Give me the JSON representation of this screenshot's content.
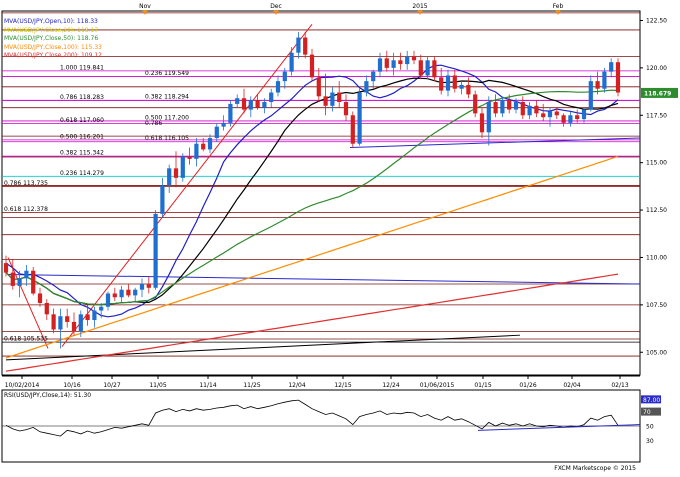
{
  "chart_data": [
    {
      "type": "candlestick",
      "symbol": "USDJPY",
      "legend": [
        {
          "label": "MVA(USD/JPY,Open,10): 118.33",
          "color": "#1e1ec8"
        },
        {
          "label": "MVA(USD/JPY,Close,20): 118.17",
          "color": "#cccc00"
        },
        {
          "label": "MVA(USD/JPY,Close,50): 118.76",
          "color": "#2e8b2e"
        },
        {
          "label": "MVA(USD/JPY,Close,100): 115.33",
          "color": "#ff8c00"
        },
        {
          "label": "MVA(USD/JPY,Close,200): 109.12",
          "color": "#e03030"
        }
      ],
      "top_month_labels": [
        "Nov",
        "Dec",
        "2015",
        "Feb"
      ],
      "x_tick_labels": [
        "10/02/2014",
        "10/16",
        "10/27",
        "11/05",
        "11/14",
        "11/25",
        "12/04",
        "12/15",
        "12/24",
        "01/06/2015",
        "01/15",
        "01/26",
        "02/04",
        "02/13"
      ],
      "y_tick_labels": [
        "122.50",
        "120.00",
        "117.50",
        "115.00",
        "112.50",
        "110.00",
        "107.50",
        "105.00"
      ],
      "ylim": [
        103.8,
        123.0
      ],
      "current_price": "118.679",
      "fib_levels": [
        {
          "label": "1.000 119.841",
          "value": 119.841,
          "color": "#cc00cc"
        },
        {
          "label": "0.236 119.549",
          "value": 119.549,
          "color": "#cc00cc"
        },
        {
          "label": "0.382 118.294",
          "value": 118.294,
          "color": "#cc00cc"
        },
        {
          "label": "0.786 118.283",
          "value": 118.283,
          "color": "#cc00cc"
        },
        {
          "label": "0.500 117.200",
          "value": 117.2,
          "color": "#cc00cc"
        },
        {
          "label": "0.618 117.060",
          "value": 117.06,
          "color": "#cc00cc"
        },
        {
          "label": "0.618 116.105",
          "value": 116.105,
          "color": "#cc00cc"
        },
        {
          "label": "0.500 116.201",
          "value": 116.201,
          "color": "#cc00cc"
        },
        {
          "label": "0.382 115.342",
          "value": 115.342,
          "color": "#cc00cc"
        },
        {
          "label": "0.236 114.279",
          "value": 114.279,
          "color": "#00cccc"
        },
        {
          "label": "0.786 113.735",
          "value": 113.735,
          "color": "#8b0000"
        },
        {
          "label": "0.618 112.378",
          "value": 112.378,
          "color": "#8b0000"
        },
        {
          "label": "0.618 105.535",
          "value": 105.535,
          "color": "#000000"
        }
      ],
      "label_7xx": "0.786",
      "candles": [
        {
          "o": 109.7,
          "h": 110.1,
          "l": 109.0,
          "c": 109.2
        },
        {
          "o": 109.2,
          "h": 109.9,
          "l": 108.3,
          "c": 108.5
        },
        {
          "o": 108.5,
          "h": 109.3,
          "l": 107.9,
          "c": 108.9
        },
        {
          "o": 108.9,
          "h": 109.6,
          "l": 108.5,
          "c": 109.3
        },
        {
          "o": 109.3,
          "h": 109.5,
          "l": 108.0,
          "c": 108.1
        },
        {
          "o": 108.1,
          "h": 108.4,
          "l": 107.4,
          "c": 107.6
        },
        {
          "o": 107.6,
          "h": 107.8,
          "l": 106.7,
          "c": 107.0
        },
        {
          "o": 107.0,
          "h": 107.3,
          "l": 106.0,
          "c": 106.2
        },
        {
          "o": 106.2,
          "h": 107.3,
          "l": 105.2,
          "c": 106.9
        },
        {
          "o": 106.9,
          "h": 107.3,
          "l": 106.3,
          "c": 106.6
        },
        {
          "o": 106.6,
          "h": 107.1,
          "l": 105.9,
          "c": 106.1
        },
        {
          "o": 106.1,
          "h": 107.2,
          "l": 105.8,
          "c": 107.0
        },
        {
          "o": 107.0,
          "h": 107.5,
          "l": 106.4,
          "c": 106.7
        },
        {
          "o": 106.7,
          "h": 107.4,
          "l": 106.3,
          "c": 107.2
        },
        {
          "o": 107.2,
          "h": 107.6,
          "l": 106.8,
          "c": 107.4
        },
        {
          "o": 107.4,
          "h": 108.2,
          "l": 107.2,
          "c": 108.1
        },
        {
          "o": 108.1,
          "h": 108.4,
          "l": 107.7,
          "c": 107.9
        },
        {
          "o": 107.9,
          "h": 108.5,
          "l": 107.6,
          "c": 108.3
        },
        {
          "o": 108.3,
          "h": 108.6,
          "l": 107.9,
          "c": 108.0
        },
        {
          "o": 108.0,
          "h": 108.4,
          "l": 107.7,
          "c": 108.3
        },
        {
          "o": 108.3,
          "h": 108.9,
          "l": 107.9,
          "c": 108.6
        },
        {
          "o": 108.6,
          "h": 109.0,
          "l": 108.1,
          "c": 108.4
        },
        {
          "o": 108.4,
          "h": 112.5,
          "l": 108.3,
          "c": 112.3
        },
        {
          "o": 112.3,
          "h": 114.2,
          "l": 112.1,
          "c": 113.8
        },
        {
          "o": 113.8,
          "h": 114.9,
          "l": 113.4,
          "c": 114.7
        },
        {
          "o": 114.7,
          "h": 115.6,
          "l": 113.7,
          "c": 114.2
        },
        {
          "o": 114.2,
          "h": 115.5,
          "l": 114.0,
          "c": 115.3
        },
        {
          "o": 115.3,
          "h": 115.8,
          "l": 114.9,
          "c": 115.2
        },
        {
          "o": 115.2,
          "h": 116.3,
          "l": 114.8,
          "c": 116.0
        },
        {
          "o": 116.0,
          "h": 116.3,
          "l": 115.6,
          "c": 115.7
        },
        {
          "o": 115.7,
          "h": 116.5,
          "l": 115.5,
          "c": 116.3
        },
        {
          "o": 116.3,
          "h": 117.1,
          "l": 116.1,
          "c": 116.9
        },
        {
          "o": 116.9,
          "h": 117.5,
          "l": 116.7,
          "c": 117.1
        },
        {
          "o": 117.1,
          "h": 118.3,
          "l": 116.9,
          "c": 118.1
        },
        {
          "o": 118.1,
          "h": 118.6,
          "l": 117.9,
          "c": 118.4
        },
        {
          "o": 118.4,
          "h": 118.9,
          "l": 117.6,
          "c": 117.8
        },
        {
          "o": 117.8,
          "h": 118.5,
          "l": 117.4,
          "c": 118.3
        },
        {
          "o": 118.3,
          "h": 118.6,
          "l": 117.8,
          "c": 117.9
        },
        {
          "o": 117.9,
          "h": 118.4,
          "l": 117.6,
          "c": 118.2
        },
        {
          "o": 118.2,
          "h": 118.9,
          "l": 117.9,
          "c": 118.7
        },
        {
          "o": 118.7,
          "h": 119.6,
          "l": 118.5,
          "c": 119.3
        },
        {
          "o": 119.3,
          "h": 120.0,
          "l": 118.9,
          "c": 119.8
        },
        {
          "o": 119.8,
          "h": 121.1,
          "l": 119.6,
          "c": 120.8
        },
        {
          "o": 120.8,
          "h": 121.9,
          "l": 120.5,
          "c": 121.6
        },
        {
          "o": 121.6,
          "h": 121.9,
          "l": 120.5,
          "c": 120.7
        },
        {
          "o": 120.7,
          "h": 121.0,
          "l": 119.3,
          "c": 119.5
        },
        {
          "o": 119.5,
          "h": 120.0,
          "l": 118.2,
          "c": 118.5
        },
        {
          "o": 118.5,
          "h": 119.7,
          "l": 117.5,
          "c": 118.0
        },
        {
          "o": 118.0,
          "h": 119.0,
          "l": 117.7,
          "c": 118.7
        },
        {
          "o": 118.7,
          "h": 119.3,
          "l": 117.9,
          "c": 118.2
        },
        {
          "o": 118.2,
          "h": 118.6,
          "l": 117.2,
          "c": 117.5
        },
        {
          "o": 117.5,
          "h": 117.7,
          "l": 115.8,
          "c": 116.0
        },
        {
          "o": 116.0,
          "h": 118.9,
          "l": 115.9,
          "c": 118.7
        },
        {
          "o": 118.7,
          "h": 119.6,
          "l": 118.5,
          "c": 119.3
        },
        {
          "o": 119.3,
          "h": 119.9,
          "l": 118.9,
          "c": 119.8
        },
        {
          "o": 119.8,
          "h": 120.8,
          "l": 119.5,
          "c": 120.5
        },
        {
          "o": 120.5,
          "h": 120.9,
          "l": 119.8,
          "c": 120.0
        },
        {
          "o": 120.0,
          "h": 120.8,
          "l": 119.6,
          "c": 120.4
        },
        {
          "o": 120.4,
          "h": 120.8,
          "l": 119.9,
          "c": 120.2
        },
        {
          "o": 120.2,
          "h": 120.9,
          "l": 119.9,
          "c": 120.6
        },
        {
          "o": 120.6,
          "h": 120.9,
          "l": 120.2,
          "c": 120.4
        },
        {
          "o": 120.4,
          "h": 120.7,
          "l": 119.4,
          "c": 119.6
        },
        {
          "o": 119.6,
          "h": 120.6,
          "l": 119.4,
          "c": 120.4
        },
        {
          "o": 120.4,
          "h": 120.6,
          "l": 119.3,
          "c": 119.5
        },
        {
          "o": 119.5,
          "h": 120.0,
          "l": 118.6,
          "c": 118.8
        },
        {
          "o": 118.8,
          "h": 119.9,
          "l": 118.5,
          "c": 119.6
        },
        {
          "o": 119.6,
          "h": 119.9,
          "l": 118.7,
          "c": 118.9
        },
        {
          "o": 118.9,
          "h": 119.3,
          "l": 118.6,
          "c": 119.1
        },
        {
          "o": 119.1,
          "h": 119.5,
          "l": 118.4,
          "c": 118.6
        },
        {
          "o": 118.6,
          "h": 118.8,
          "l": 117.4,
          "c": 117.6
        },
        {
          "o": 117.6,
          "h": 117.9,
          "l": 116.3,
          "c": 116.6
        },
        {
          "o": 116.6,
          "h": 118.5,
          "l": 115.9,
          "c": 118.2
        },
        {
          "o": 118.2,
          "h": 118.6,
          "l": 117.4,
          "c": 117.6
        },
        {
          "o": 117.6,
          "h": 118.5,
          "l": 117.4,
          "c": 118.3
        },
        {
          "o": 118.3,
          "h": 118.6,
          "l": 117.6,
          "c": 117.8
        },
        {
          "o": 117.8,
          "h": 118.4,
          "l": 117.6,
          "c": 118.2
        },
        {
          "o": 118.2,
          "h": 118.5,
          "l": 117.3,
          "c": 117.5
        },
        {
          "o": 117.5,
          "h": 118.2,
          "l": 117.3,
          "c": 118.0
        },
        {
          "o": 118.0,
          "h": 118.3,
          "l": 117.4,
          "c": 117.6
        },
        {
          "o": 117.6,
          "h": 118.1,
          "l": 117.2,
          "c": 117.4
        },
        {
          "o": 117.4,
          "h": 117.9,
          "l": 116.9,
          "c": 117.7
        },
        {
          "o": 117.7,
          "h": 117.9,
          "l": 117.3,
          "c": 117.5
        },
        {
          "o": 117.5,
          "h": 117.6,
          "l": 116.9,
          "c": 117.1
        },
        {
          "o": 117.1,
          "h": 117.7,
          "l": 116.9,
          "c": 117.5
        },
        {
          "o": 117.5,
          "h": 117.8,
          "l": 117.1,
          "c": 117.3
        },
        {
          "o": 117.3,
          "h": 117.9,
          "l": 117.1,
          "c": 117.8
        },
        {
          "o": 117.8,
          "h": 119.6,
          "l": 117.7,
          "c": 119.3
        },
        {
          "o": 119.3,
          "h": 119.8,
          "l": 118.6,
          "c": 118.9
        },
        {
          "o": 118.9,
          "h": 120.0,
          "l": 118.7,
          "c": 119.8
        },
        {
          "o": 119.8,
          "h": 120.5,
          "l": 119.5,
          "c": 120.3
        },
        {
          "o": 120.3,
          "h": 120.5,
          "l": 118.5,
          "c": 118.7
        }
      ],
      "rsi": {
        "label": "RSI(USD/JPY,Close,14): 51.30",
        "levels": [
          "87.00",
          "70",
          "50",
          "30"
        ],
        "values": [
          51,
          46,
          43,
          45,
          48,
          42,
          40,
          38,
          36,
          44,
          42,
          39,
          43,
          40,
          42,
          45,
          48,
          47,
          49,
          51,
          53,
          51,
          68,
          72,
          74,
          70,
          73,
          71,
          74,
          72,
          73,
          75,
          76,
          78,
          79,
          74,
          77,
          74,
          76,
          78,
          81,
          83,
          85,
          86,
          80,
          74,
          70,
          66,
          68,
          64,
          60,
          52,
          63,
          66,
          68,
          71,
          66,
          68,
          67,
          69,
          68,
          63,
          66,
          61,
          58,
          63,
          58,
          60,
          56,
          51,
          46,
          55,
          50,
          54,
          51,
          53,
          50,
          53,
          50,
          49,
          51,
          50,
          48,
          50,
          49,
          52,
          61,
          58,
          63,
          65,
          51
        ]
      },
      "watermark": "FXCM Marketscope © 2015"
    }
  ]
}
